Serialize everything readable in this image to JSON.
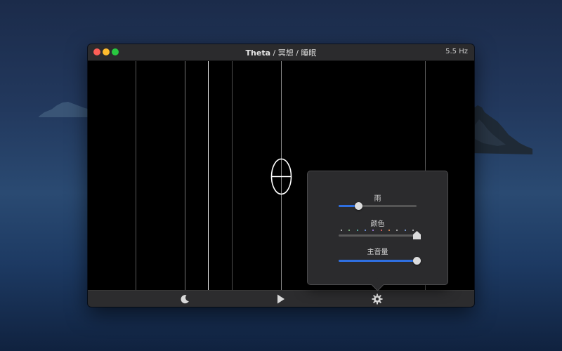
{
  "window": {
    "title_bold": "Theta",
    "title_rest": " / 冥想 / 睡眠",
    "frequency": "5.5 Hz"
  },
  "popover": {
    "rain": {
      "label": "雨",
      "value": 0.25
    },
    "color": {
      "label": "颜色",
      "value": 1.0,
      "tick_colors": [
        "#cfcfcf",
        "#8fd18f",
        "#5fd1c1",
        "#7fa8ff",
        "#b58cff",
        "#ff6b6b",
        "#ff9f5a",
        "#cfcfcf",
        "#8fb8ff",
        "#cfcfcf"
      ]
    },
    "master_volume": {
      "label": "主音量",
      "value": 1.0
    }
  },
  "toolbar": {
    "moon_icon": "moon-icon",
    "play_icon": "play-icon",
    "settings_icon": "gear-icon"
  },
  "colors": {
    "accent": "#2f6fe0",
    "window_bg": "#000000",
    "toolbar_bg": "#2c2c2e"
  }
}
